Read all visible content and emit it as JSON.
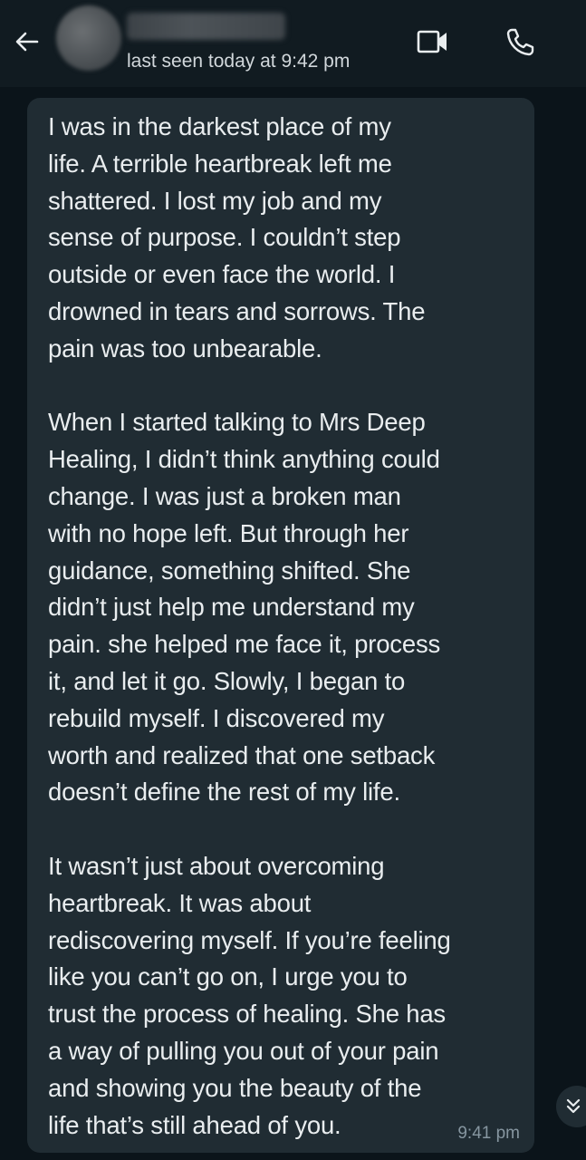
{
  "header": {
    "back_icon": "arrow-left-icon",
    "contact_name": "",
    "status": "last seen today at 9:42 pm",
    "video_icon": "video-call-icon",
    "call_icon": "phone-icon"
  },
  "message": {
    "text": "I was in the darkest place of my\nlife. A terrible heartbreak left me\nshattered. I lost my job and my\nsense of purpose. I couldn’t step\noutside or even face the world. I\ndrowned in tears and sorrows.  The\npain was too unbearable.\n\nWhen I started talking to Mrs Deep\nHealing, I didn’t think anything could\nchange. I was just a broken man\nwith no hope left. But through her\nguidance, something shifted. She\ndidn’t just help me understand my\npain. she helped me face it, process\nit, and let it go. Slowly, I began to\nrebuild myself.  I discovered my\nworth and realized that one setback\ndoesn’t define the rest of my life.\n\nIt wasn’t just about overcoming\nheartbreak. It was about\nrediscovering myself. If you’re feeling\nlike you can’t go on, I urge you to\ntrust the process of healing. She has\na way of pulling you out of your pain\nand showing you the beauty of the\nlife that’s still ahead of you.",
    "time": "9:41 pm"
  },
  "scroll_button": {
    "icon": "double-chevron-down-icon"
  },
  "colors": {
    "header_bg": "#111b21",
    "chat_bg": "#0b141a",
    "bubble_bg": "#202c33",
    "text": "#e9edef",
    "meta_text": "#8696a0"
  }
}
